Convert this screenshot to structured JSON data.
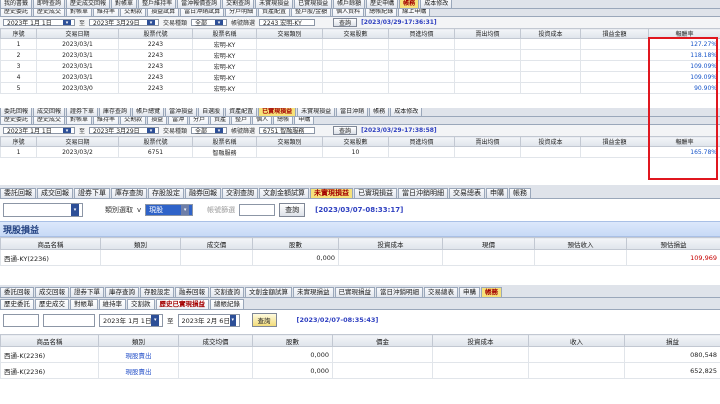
{
  "panel1": {
    "tabs": [
      "我的書籤",
      "即時查詢",
      "歷史成交回報",
      "對帳單",
      "整戶維持率",
      "當沖報價查詢",
      "交割查詢",
      "未實現損益",
      "已實現損益",
      "帳戶餘額",
      "歷史申購",
      "帳務",
      "成本修改"
    ],
    "active_tab": 11,
    "subtabs": [
      "歷史委託",
      "歷史成交",
      "對帳單",
      "維持率",
      "交割款",
      "損益試算",
      "當日沖銷試算",
      "分戶明細",
      "資產配置",
      "整戶股/金額",
      "個人資料",
      "總帳紀錄",
      "線上申購"
    ],
    "toolbar": {
      "date_from": "2023年 1月 1日",
      "sep": "至",
      "date_to": "2023年 3月29日",
      "kind_label": "交易種類",
      "kind_value": "全部",
      "account_label": "帳號篩選",
      "account_value": "2243 宏明-KY",
      "query": "查詢",
      "timestamp": "[2023/03/29-17:36:31]"
    },
    "headers": [
      "序號",
      "交易日期",
      "股票代號",
      "股票名稱",
      "交易類別",
      "交易股數",
      "買進均價",
      "賣出均價",
      "投資成本",
      "損益金額",
      "報酬率"
    ],
    "rows": [
      [
        "1",
        "2023/03/1",
        "2243",
        "宏明-KY",
        "",
        "",
        "",
        "",
        "",
        "",
        "127.27%"
      ],
      [
        "2",
        "2023/03/1",
        "2243",
        "宏明-KY",
        "",
        "",
        "",
        "",
        "",
        "",
        "118.18%"
      ],
      [
        "3",
        "2023/03/1",
        "2243",
        "宏明-KY",
        "",
        "",
        "",
        "",
        "",
        "",
        "109.09%"
      ],
      [
        "4",
        "2023/03/1",
        "2243",
        "宏明-KY",
        "",
        "",
        "",
        "",
        "",
        "",
        "109.09%"
      ],
      [
        "5",
        "2023/03/0",
        "2243",
        "宏明-KY",
        "",
        "",
        "",
        "",
        "",
        "",
        "90.90%"
      ]
    ]
  },
  "panel2": {
    "tabs": [
      "委託回報",
      "成交回報",
      "證券下單",
      "庫存查詢",
      "帳戶總覽",
      "當沖損益",
      "自選股",
      "資產配置",
      "已實現損益",
      "未實現損益",
      "當日沖銷",
      "帳務",
      "成本修改"
    ],
    "active_tab": 8,
    "subtabs": [
      "歷史委託",
      "歷史成交",
      "對帳單",
      "維持率",
      "交割款",
      "損益",
      "當沖",
      "分戶",
      "資產",
      "整戶",
      "個人",
      "總帳",
      "申購"
    ],
    "toolbar": {
      "date_from": "2023年 1月 1日",
      "sep": "至",
      "date_to": "2023年 3月29日",
      "kind_label": "交易種類",
      "kind_value": "全部",
      "account_label": "帳號篩選",
      "account_value": "6751 智融服務",
      "query": "查詢",
      "timestamp": "[2023/03/29-17:38:58]"
    },
    "headers": [
      "序號",
      "交易日期",
      "股票代號",
      "股票名稱",
      "交易類別",
      "交易股數",
      "買進均價",
      "賣出均價",
      "投資成本",
      "損益金額",
      "報酬率"
    ],
    "rows": [
      [
        "1",
        "2023/03/2",
        "6751",
        "智融服務",
        "",
        "10",
        "",
        "",
        "",
        "",
        "165.78%"
      ]
    ]
  },
  "panel3": {
    "tabs": [
      "委託回報",
      "成交回報",
      "證券下單",
      "庫存查詢",
      "存股設定",
      "融券回報",
      "交割查詢",
      "文創金額試算",
      "未實現損益",
      "已實現損益",
      "當日沖銷明細",
      "交易總表",
      "申購",
      "帳務"
    ],
    "active_tab": 8,
    "toolbar": {
      "kind_label": "類別選取",
      "kind_value": "v",
      "mode_value": "現股",
      "account_label": "帳號篩選",
      "query": "查詢",
      "timestamp": "[2023/03/07-08:33:17]"
    },
    "section_title": "現股損益",
    "headers": [
      "商品名稱",
      "類別",
      "成交價",
      "股數",
      "投資成本",
      "現價",
      "預估收入",
      "預估損益"
    ],
    "rows": [
      [
        "西通-KY(2236)",
        "",
        "",
        "0,000",
        "",
        "",
        "",
        "109,969"
      ]
    ]
  },
  "panel4": {
    "tabs": [
      "委託回報",
      "成交回報",
      "證券下單",
      "庫存查詢",
      "存股設定",
      "融券回報",
      "交割查詢",
      "文創金額試算",
      "未實現損益",
      "已實現損益",
      "當日沖銷明細",
      "交易總表",
      "申購",
      "帳務"
    ],
    "active_tab": 13,
    "subtabs": [
      "歷史委託",
      "歷史成交",
      "對帳單",
      "維持率",
      "交割款",
      "歷史已實現損益",
      "總帳紀錄"
    ],
    "active_subtab": 5,
    "toolbar": {
      "date_from": "2023年 1月 1日",
      "sep": "至",
      "date_to": "2023年 2月 6日",
      "query": "查詢",
      "timestamp": "[2023/02/07-08:35:43]"
    },
    "headers": [
      "商品名稱",
      "類別",
      "成交均價",
      "股數",
      "價金",
      "投資成本",
      "收入",
      "損益"
    ],
    "rows": [
      [
        "西通-K(2236)",
        "現股賣出",
        "",
        "0,000",
        "",
        "",
        "",
        "080,548"
      ],
      [
        "西通-K(2236)",
        "現股賣出",
        "",
        "0,000",
        "",
        "",
        "",
        "652,825"
      ]
    ]
  }
}
